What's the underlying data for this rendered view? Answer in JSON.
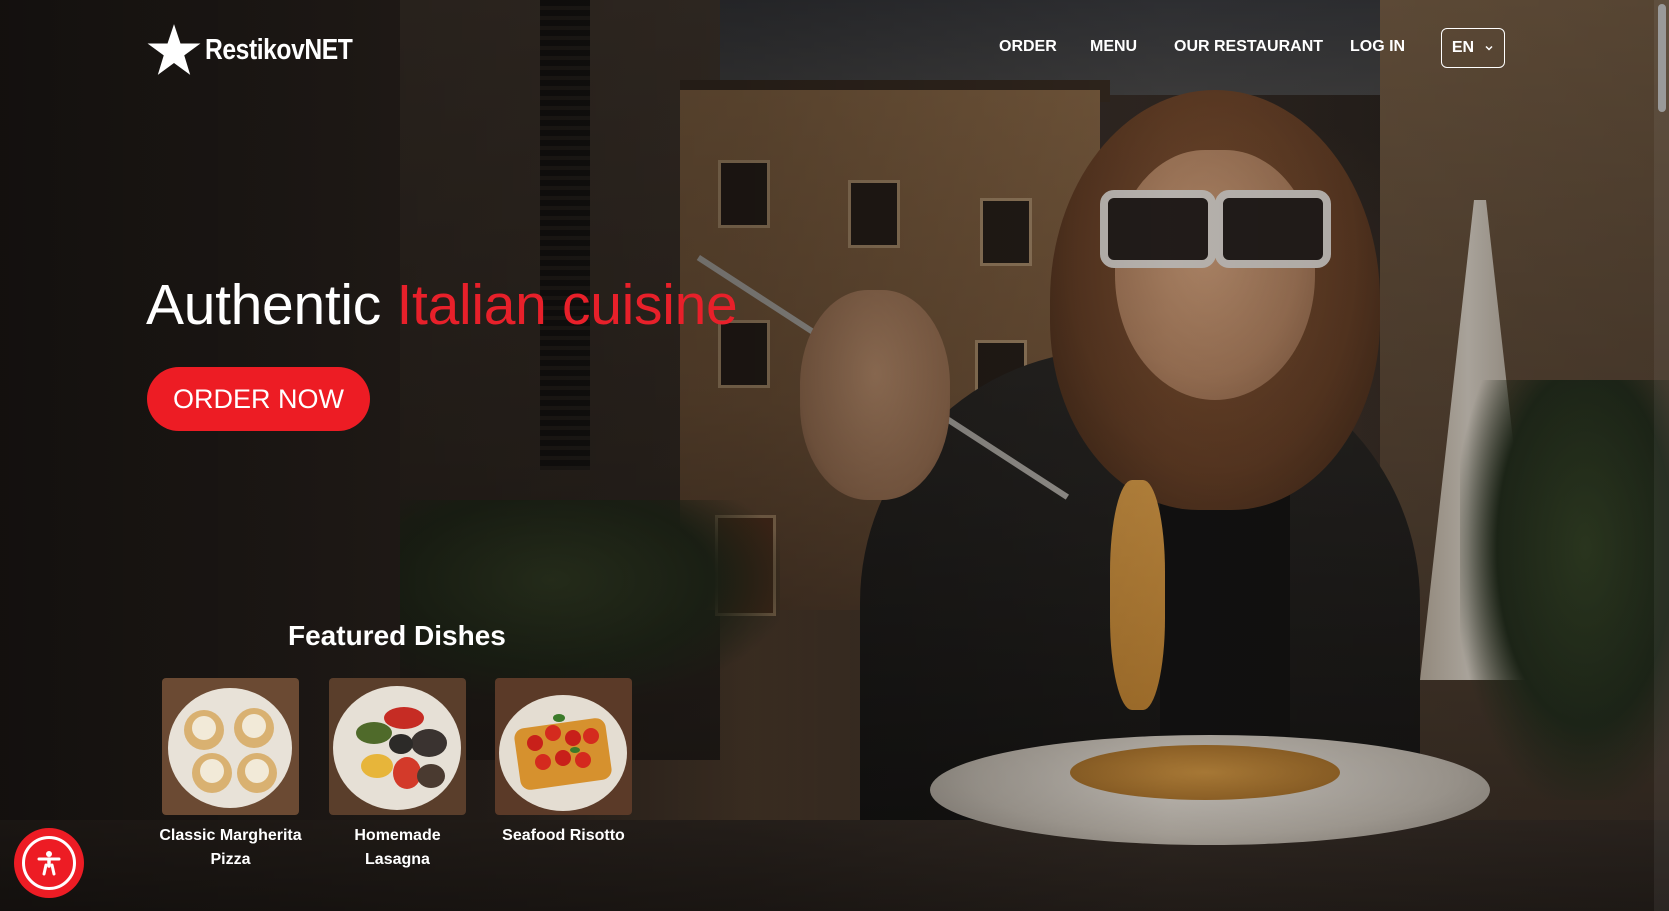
{
  "brand": {
    "name": "RestikovNET",
    "logo_icon": "star-icon"
  },
  "nav": {
    "items": [
      {
        "label": "ORDER"
      },
      {
        "label": "MENU"
      },
      {
        "label": "OUR RESTAURANT"
      },
      {
        "label": "LOG IN"
      }
    ],
    "language": {
      "selected": "EN",
      "icon": "chevron-down-icon"
    }
  },
  "hero": {
    "headline_part1": "Authentic ",
    "headline_accent": "Italian cuisine",
    "cta_label": "ORDER NOW"
  },
  "featured": {
    "title": "Featured Dishes",
    "dishes": [
      {
        "name": "Classic Margherita Pizza"
      },
      {
        "name": "Homemade Lasagna"
      },
      {
        "name": "Seafood Risotto"
      }
    ]
  },
  "accessibility": {
    "icon": "accessibility-icon"
  },
  "colors": {
    "accent": "#ed1c24",
    "headline_accent": "#e8202a",
    "text": "#ffffff"
  }
}
